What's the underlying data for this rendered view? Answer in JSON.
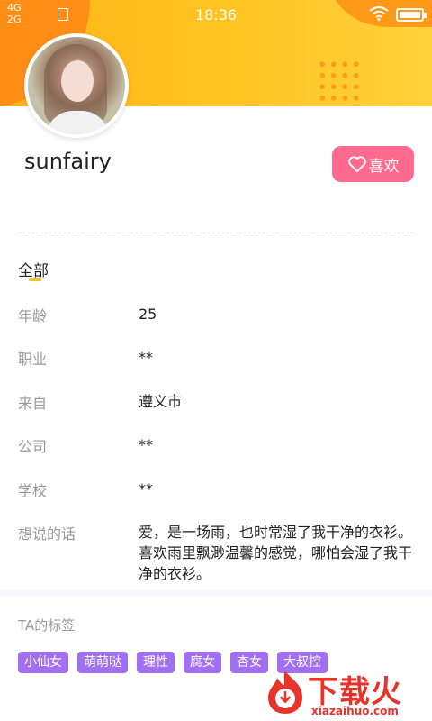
{
  "status_bar": {
    "network_top": "4G",
    "network_bottom": "2G",
    "time": "18:36"
  },
  "profile": {
    "username": "sunfairy",
    "like_label": "喜欢"
  },
  "tabs": {
    "active": "全部"
  },
  "info": [
    {
      "label": "年龄",
      "value": "25"
    },
    {
      "label": "职业",
      "value": "**"
    },
    {
      "label": "来自",
      "value": "遵义市"
    },
    {
      "label": "公司",
      "value": "**"
    },
    {
      "label": "学校",
      "value": "**"
    },
    {
      "label": "想说的话",
      "value": "爱，是一场雨，也时常湿了我干净的衣衫。喜欢雨里飘渺温馨的感觉，哪怕会湿了我干净的衣衫。"
    }
  ],
  "tags": {
    "title": "TA的标签",
    "items": [
      "小仙女",
      "萌萌哒",
      "理性",
      "腐女",
      "杏女",
      "大叔控"
    ]
  },
  "watermark": {
    "brand": "下载火",
    "domain": "xiazaihuo.com"
  },
  "colors": {
    "header_yellow": "#ffc21f",
    "header_orange": "#ff8a16",
    "like_pink": "#ff6a8e",
    "tag_purple": "#a070f0",
    "watermark_red": "#e8332a"
  }
}
